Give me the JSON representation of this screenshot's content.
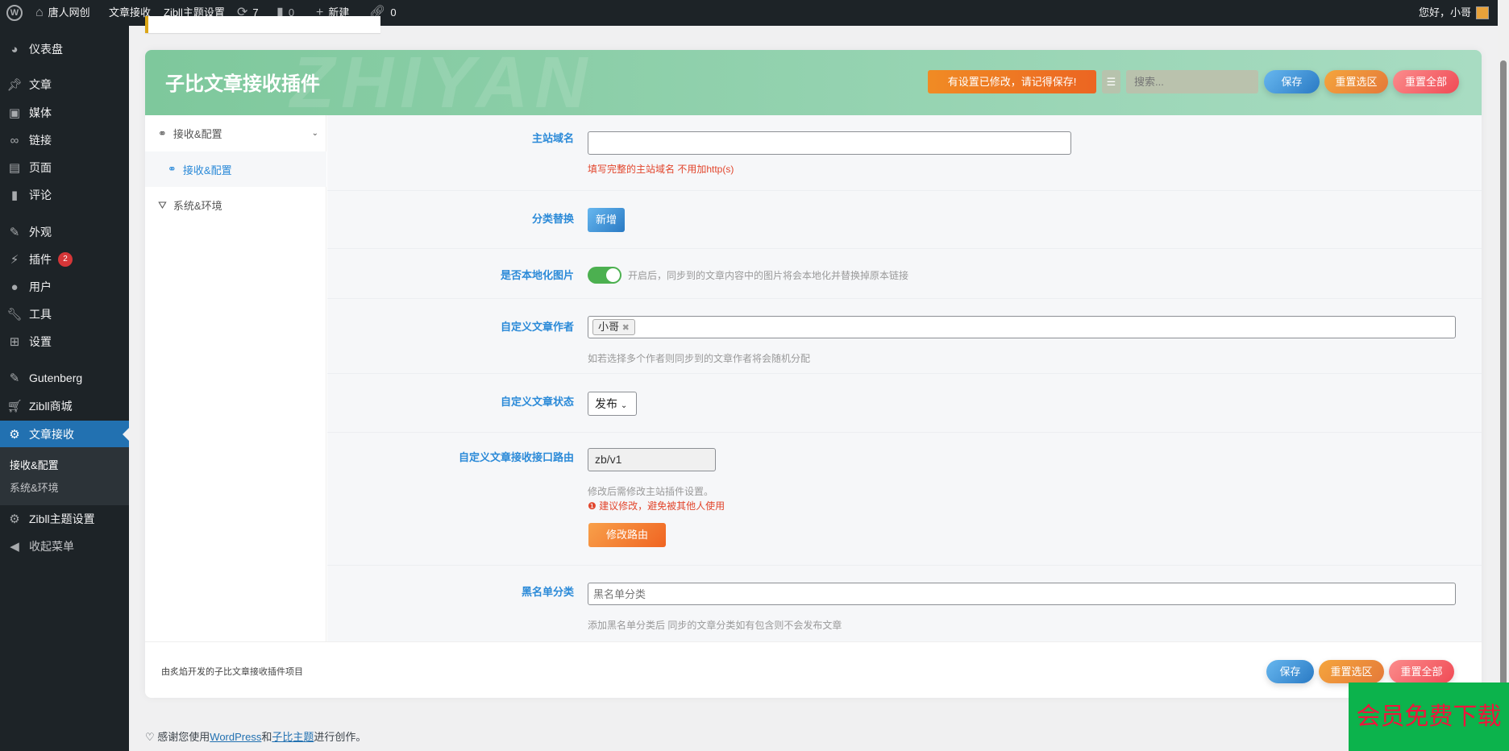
{
  "adminbar": {
    "site": "唐人网创",
    "item1": "文章接收",
    "item2": "Zibll主题设置",
    "updates": "7",
    "comments": "0",
    "new": "新建",
    "links": "0",
    "greeting": "您好，小哥"
  },
  "sidebar": {
    "items": [
      {
        "label": "仪表盘"
      },
      {
        "label": "文章"
      },
      {
        "label": "媒体"
      },
      {
        "label": "链接"
      },
      {
        "label": "页面"
      },
      {
        "label": "评论"
      },
      {
        "label": "外观"
      },
      {
        "label": "插件",
        "badge": "2"
      },
      {
        "label": "用户"
      },
      {
        "label": "工具"
      },
      {
        "label": "设置"
      },
      {
        "label": "Gutenberg"
      },
      {
        "label": "Zibll商城"
      },
      {
        "label": "文章接收"
      },
      {
        "label": "Zibll主题设置"
      },
      {
        "label": "收起菜单"
      }
    ],
    "submenu": [
      "接收&配置",
      "系统&环境"
    ]
  },
  "header": {
    "title": "子比文章接收插件",
    "watermark": "ZHIYAN",
    "notice": "有设置已修改，请记得保存!",
    "search_placeholder": "搜索...",
    "save": "保存",
    "reset_section": "重置选区",
    "reset_all": "重置全部"
  },
  "nav": {
    "section1": "接收&配置",
    "section1_child": "接收&配置",
    "section2": "系统&环境"
  },
  "fields": {
    "domain": {
      "label": "主站域名",
      "value": "",
      "help": "填写完整的主站域名 不用加http(s)"
    },
    "category": {
      "label": "分类替换",
      "button": "新增"
    },
    "localize": {
      "label": "是否本地化图片",
      "on": true,
      "help": "开启后，同步到的文章内容中的图片将会本地化并替换掉原本链接"
    },
    "author": {
      "label": "自定义文章作者",
      "tag": "小哥",
      "help": "如若选择多个作者则同步到的文章作者将会随机分配"
    },
    "status": {
      "label": "自定义文章状态",
      "value": "发布"
    },
    "route": {
      "label": "自定义文章接收接口路由",
      "value": "zb/v1",
      "help": "修改后需修改主站插件设置。",
      "warning": "建议修改，避免被其他人使用",
      "button": "修改路由"
    },
    "blacklist": {
      "label": "黑名单分类",
      "placeholder": "黑名单分类",
      "help": "添加黑名单分类后 同步的文章分类如有包含则不会发布文章"
    }
  },
  "footer": {
    "credit": "由炙焰开发的子比文章接收插件项目",
    "save": "保存",
    "reset_section": "重置选区",
    "reset_all": "重置全部"
  },
  "bottom": {
    "prefix": "感谢您使用",
    "wp": "WordPress",
    "and": "和",
    "theme": "子比主题",
    "suffix": "进行创作。"
  },
  "promo": "会员免费下载"
}
